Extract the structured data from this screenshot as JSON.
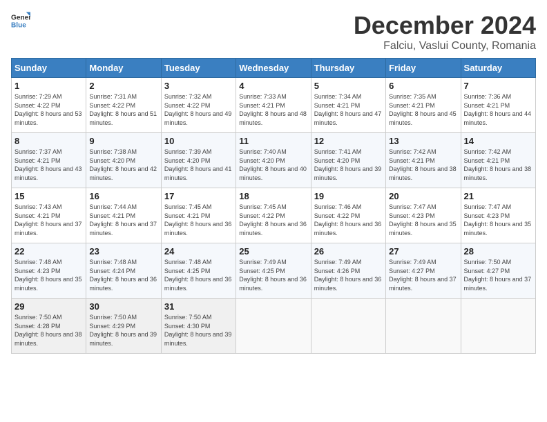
{
  "logo": {
    "general": "General",
    "blue": "Blue"
  },
  "title": "December 2024",
  "subtitle": "Falciu, Vaslui County, Romania",
  "weekdays": [
    "Sunday",
    "Monday",
    "Tuesday",
    "Wednesday",
    "Thursday",
    "Friday",
    "Saturday"
  ],
  "weeks": [
    [
      {
        "day": "1",
        "sunrise": "7:29 AM",
        "sunset": "4:22 PM",
        "daylight": "8 hours and 53 minutes."
      },
      {
        "day": "2",
        "sunrise": "7:31 AM",
        "sunset": "4:22 PM",
        "daylight": "8 hours and 51 minutes."
      },
      {
        "day": "3",
        "sunrise": "7:32 AM",
        "sunset": "4:22 PM",
        "daylight": "8 hours and 49 minutes."
      },
      {
        "day": "4",
        "sunrise": "7:33 AM",
        "sunset": "4:21 PM",
        "daylight": "8 hours and 48 minutes."
      },
      {
        "day": "5",
        "sunrise": "7:34 AM",
        "sunset": "4:21 PM",
        "daylight": "8 hours and 47 minutes."
      },
      {
        "day": "6",
        "sunrise": "7:35 AM",
        "sunset": "4:21 PM",
        "daylight": "8 hours and 45 minutes."
      },
      {
        "day": "7",
        "sunrise": "7:36 AM",
        "sunset": "4:21 PM",
        "daylight": "8 hours and 44 minutes."
      }
    ],
    [
      {
        "day": "8",
        "sunrise": "7:37 AM",
        "sunset": "4:21 PM",
        "daylight": "8 hours and 43 minutes."
      },
      {
        "day": "9",
        "sunrise": "7:38 AM",
        "sunset": "4:20 PM",
        "daylight": "8 hours and 42 minutes."
      },
      {
        "day": "10",
        "sunrise": "7:39 AM",
        "sunset": "4:20 PM",
        "daylight": "8 hours and 41 minutes."
      },
      {
        "day": "11",
        "sunrise": "7:40 AM",
        "sunset": "4:20 PM",
        "daylight": "8 hours and 40 minutes."
      },
      {
        "day": "12",
        "sunrise": "7:41 AM",
        "sunset": "4:20 PM",
        "daylight": "8 hours and 39 minutes."
      },
      {
        "day": "13",
        "sunrise": "7:42 AM",
        "sunset": "4:21 PM",
        "daylight": "8 hours and 38 minutes."
      },
      {
        "day": "14",
        "sunrise": "7:42 AM",
        "sunset": "4:21 PM",
        "daylight": "8 hours and 38 minutes."
      }
    ],
    [
      {
        "day": "15",
        "sunrise": "7:43 AM",
        "sunset": "4:21 PM",
        "daylight": "8 hours and 37 minutes."
      },
      {
        "day": "16",
        "sunrise": "7:44 AM",
        "sunset": "4:21 PM",
        "daylight": "8 hours and 37 minutes."
      },
      {
        "day": "17",
        "sunrise": "7:45 AM",
        "sunset": "4:21 PM",
        "daylight": "8 hours and 36 minutes."
      },
      {
        "day": "18",
        "sunrise": "7:45 AM",
        "sunset": "4:22 PM",
        "daylight": "8 hours and 36 minutes."
      },
      {
        "day": "19",
        "sunrise": "7:46 AM",
        "sunset": "4:22 PM",
        "daylight": "8 hours and 36 minutes."
      },
      {
        "day": "20",
        "sunrise": "7:47 AM",
        "sunset": "4:23 PM",
        "daylight": "8 hours and 35 minutes."
      },
      {
        "day": "21",
        "sunrise": "7:47 AM",
        "sunset": "4:23 PM",
        "daylight": "8 hours and 35 minutes."
      }
    ],
    [
      {
        "day": "22",
        "sunrise": "7:48 AM",
        "sunset": "4:23 PM",
        "daylight": "8 hours and 35 minutes."
      },
      {
        "day": "23",
        "sunrise": "7:48 AM",
        "sunset": "4:24 PM",
        "daylight": "8 hours and 36 minutes."
      },
      {
        "day": "24",
        "sunrise": "7:48 AM",
        "sunset": "4:25 PM",
        "daylight": "8 hours and 36 minutes."
      },
      {
        "day": "25",
        "sunrise": "7:49 AM",
        "sunset": "4:25 PM",
        "daylight": "8 hours and 36 minutes."
      },
      {
        "day": "26",
        "sunrise": "7:49 AM",
        "sunset": "4:26 PM",
        "daylight": "8 hours and 36 minutes."
      },
      {
        "day": "27",
        "sunrise": "7:49 AM",
        "sunset": "4:27 PM",
        "daylight": "8 hours and 37 minutes."
      },
      {
        "day": "28",
        "sunrise": "7:50 AM",
        "sunset": "4:27 PM",
        "daylight": "8 hours and 37 minutes."
      }
    ],
    [
      {
        "day": "29",
        "sunrise": "7:50 AM",
        "sunset": "4:28 PM",
        "daylight": "8 hours and 38 minutes."
      },
      {
        "day": "30",
        "sunrise": "7:50 AM",
        "sunset": "4:29 PM",
        "daylight": "8 hours and 39 minutes."
      },
      {
        "day": "31",
        "sunrise": "7:50 AM",
        "sunset": "4:30 PM",
        "daylight": "8 hours and 39 minutes."
      },
      null,
      null,
      null,
      null
    ]
  ]
}
